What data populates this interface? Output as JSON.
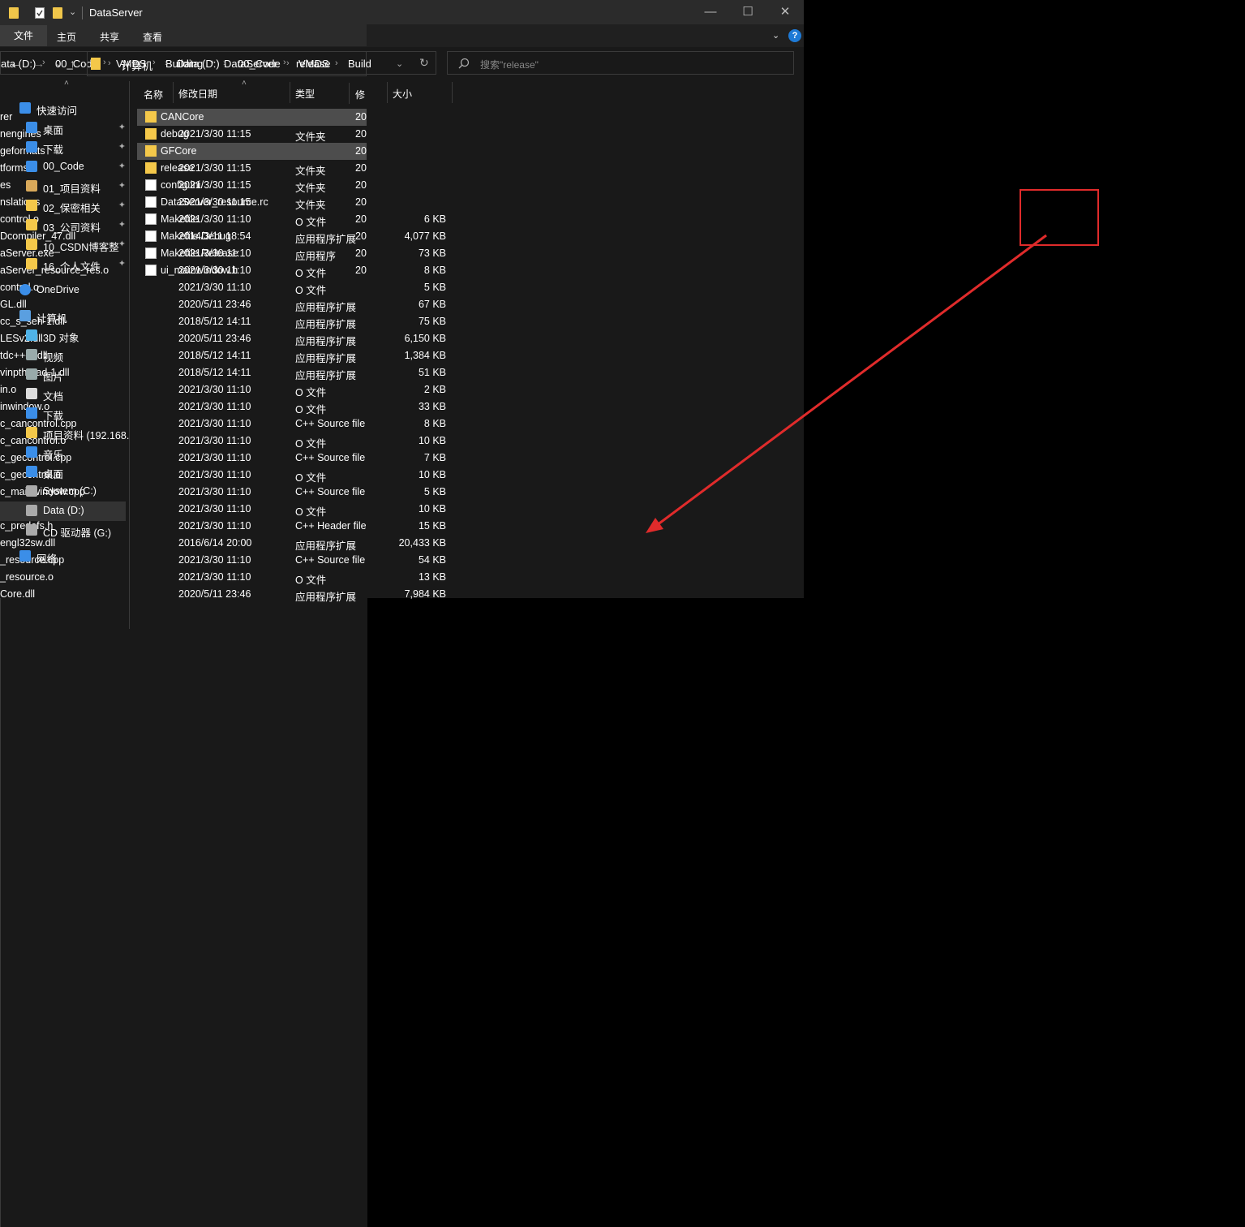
{
  "left_window": {
    "caption": {
      "minimize": "—",
      "maximize": "☐",
      "close": "✕"
    },
    "help_icon": "?",
    "address": [
      "ata (D:)",
      "00_Code",
      "VMDS",
      "Building",
      "DataServer",
      "release"
    ],
    "search_placeholder": "搜索\"release\"",
    "columns": {
      "name": "",
      "date": "修改日期",
      "type": "类型",
      "size": "大小"
    },
    "rows": [
      {
        "name": "rer",
        "date": "2021/3/30 11:15",
        "type": "文件夹",
        "size": ""
      },
      {
        "name": "nengines",
        "date": "2021/3/30 11:15",
        "type": "文件夹",
        "size": ""
      },
      {
        "name": "geformats",
        "date": "2021/3/30 11:15",
        "type": "文件夹",
        "size": ""
      },
      {
        "name": "tforms",
        "date": "2021/3/30 11:15",
        "type": "文件夹",
        "size": ""
      },
      {
        "name": "es",
        "date": "2021/3/30 11:15",
        "type": "文件夹",
        "size": ""
      },
      {
        "name": "nslations",
        "date": "2021/3/30 11:15",
        "type": "文件夹",
        "size": ""
      },
      {
        "name": "control.o",
        "date": "2021/3/30 11:10",
        "type": "O 文件",
        "size": "6 KB"
      },
      {
        "name": "Dcompiler_47.dll",
        "date": "2014/3/11 18:54",
        "type": "应用程序扩展",
        "size": "4,077 KB"
      },
      {
        "name": "aServer.exe",
        "date": "2021/3/30 11:10",
        "type": "应用程序",
        "size": "73 KB"
      },
      {
        "name": "aServer_resource_res.o",
        "date": "2021/3/30 11:10",
        "type": "O 文件",
        "size": "8 KB"
      },
      {
        "name": "control.o",
        "date": "2021/3/30 11:10",
        "type": "O 文件",
        "size": "5 KB"
      },
      {
        "name": "GL.dll",
        "date": "2020/5/11 23:46",
        "type": "应用程序扩展",
        "size": "67 KB"
      },
      {
        "name": "cc_s_seh-1.dll",
        "date": "2018/5/12 14:11",
        "type": "应用程序扩展",
        "size": "75 KB"
      },
      {
        "name": "LESv2.dll",
        "date": "2020/5/11 23:46",
        "type": "应用程序扩展",
        "size": "6,150 KB"
      },
      {
        "name": "tdc++-6.dll",
        "date": "2018/5/12 14:11",
        "type": "应用程序扩展",
        "size": "1,384 KB"
      },
      {
        "name": "vinpthread-1.dll",
        "date": "2018/5/12 14:11",
        "type": "应用程序扩展",
        "size": "51 KB"
      },
      {
        "name": "in.o",
        "date": "2021/3/30 11:10",
        "type": "O 文件",
        "size": "2 KB"
      },
      {
        "name": "inwindow.o",
        "date": "2021/3/30 11:10",
        "type": "O 文件",
        "size": "33 KB"
      },
      {
        "name": "c_cancontrol.cpp",
        "date": "2021/3/30 11:10",
        "type": "C++ Source file",
        "size": "8 KB"
      },
      {
        "name": "c_cancontrol.o",
        "date": "2021/3/30 11:10",
        "type": "O 文件",
        "size": "10 KB"
      },
      {
        "name": "c_gecontrol.cpp",
        "date": "2021/3/30 11:10",
        "type": "C++ Source file",
        "size": "7 KB"
      },
      {
        "name": "c_gecontrol.o",
        "date": "2021/3/30 11:10",
        "type": "O 文件",
        "size": "10 KB"
      },
      {
        "name": "c_mainwindow.cpp",
        "date": "2021/3/30 11:10",
        "type": "C++ Source file",
        "size": "5 KB"
      },
      {
        "name": "c_mainwindow.o",
        "date": "2021/3/30 11:10",
        "type": "O 文件",
        "size": "10 KB"
      },
      {
        "name": "c_predefs.h",
        "date": "2021/3/30 11:10",
        "type": "C++ Header file",
        "size": "15 KB"
      },
      {
        "name": "engl32sw.dll",
        "date": "2016/6/14 20:00",
        "type": "应用程序扩展",
        "size": "20,433 KB"
      },
      {
        "name": "_resource.cpp",
        "date": "2021/3/30 11:10",
        "type": "C++ Source file",
        "size": "54 KB"
      },
      {
        "name": "_resource.o",
        "date": "2021/3/30 11:10",
        "type": "O 文件",
        "size": "13 KB"
      },
      {
        "name": "Core.dll",
        "date": "2020/5/11 23:46",
        "type": "应用程序扩展",
        "size": "7,984 KB"
      }
    ]
  },
  "right_window": {
    "title": "DataServer",
    "tabs": [
      "文件",
      "主页",
      "共享",
      "查看"
    ],
    "address": [
      "计算机",
      "Data (D:)",
      "00_Code",
      "VMDS",
      "Build"
    ],
    "column_name": "名称",
    "column_date": "修",
    "nav_pane": [
      {
        "label": "快速访问",
        "icon": "star-icon",
        "pinned": false,
        "level": 0
      },
      {
        "label": "桌面",
        "icon": "desktop-icon",
        "pinned": true,
        "level": 1
      },
      {
        "label": "下载",
        "icon": "download-icon",
        "pinned": true,
        "level": 1
      },
      {
        "label": "00_Code",
        "icon": "star-icon",
        "pinned": true,
        "level": 1
      },
      {
        "label": "01_项目资料",
        "icon": "people-icon",
        "pinned": true,
        "level": 1
      },
      {
        "label": "02_保密相关",
        "icon": "folder-icon",
        "pinned": true,
        "level": 1
      },
      {
        "label": "03_公司资料",
        "icon": "folder-icon",
        "pinned": true,
        "level": 1
      },
      {
        "label": "10_CSDN博客整",
        "icon": "folder-icon",
        "pinned": true,
        "level": 1
      },
      {
        "label": "16_个人文件",
        "icon": "lock-folder-icon",
        "pinned": true,
        "level": 1
      },
      {
        "label": "OneDrive",
        "icon": "cloud-icon",
        "pinned": false,
        "level": 0
      },
      {
        "label": "计算机",
        "icon": "computer-icon",
        "pinned": false,
        "level": 0
      },
      {
        "label": "3D 对象",
        "icon": "cube-icon",
        "pinned": false,
        "level": 1
      },
      {
        "label": "视频",
        "icon": "video-icon",
        "pinned": false,
        "level": 1
      },
      {
        "label": "图片",
        "icon": "picture-icon",
        "pinned": false,
        "level": 1
      },
      {
        "label": "文档",
        "icon": "document-icon",
        "pinned": false,
        "level": 1
      },
      {
        "label": "下载",
        "icon": "download-icon",
        "pinned": false,
        "level": 1
      },
      {
        "label": "项目资料 (192.168.",
        "icon": "network-drive-icon",
        "pinned": false,
        "level": 1
      },
      {
        "label": "音乐",
        "icon": "music-icon",
        "pinned": false,
        "level": 1
      },
      {
        "label": "桌面",
        "icon": "desktop-icon",
        "pinned": false,
        "level": 1
      },
      {
        "label": "System (C:)",
        "icon": "drive-icon",
        "pinned": false,
        "level": 1
      },
      {
        "label": "Data (D:)",
        "icon": "drive-icon",
        "pinned": false,
        "level": 1,
        "selected": true
      },
      {
        "label": "CD 驱动器 (G:)",
        "icon": "cd-drive-icon",
        "pinned": false,
        "level": 1
      },
      {
        "label": "网络",
        "icon": "network-icon",
        "pinned": false,
        "level": 0
      }
    ],
    "files": [
      {
        "name": "CANCore",
        "kind": "folder",
        "date": "20",
        "highlight": true
      },
      {
        "name": "debug",
        "kind": "folder",
        "date": "20",
        "highlight": false
      },
      {
        "name": "GFCore",
        "kind": "folder",
        "date": "20",
        "highlight": true
      },
      {
        "name": "release",
        "kind": "folder",
        "date": "20",
        "highlight": false
      },
      {
        "name": "config.ini",
        "kind": "ini",
        "date": "20",
        "highlight": false
      },
      {
        "name": "DataServer_resource.rc",
        "kind": "rc",
        "date": "20",
        "highlight": false
      },
      {
        "name": "Makefile",
        "kind": "file",
        "date": "20",
        "highlight": false
      },
      {
        "name": "Makefile.Debug",
        "kind": "file",
        "date": "20",
        "highlight": false
      },
      {
        "name": "Makefile.Release",
        "kind": "file",
        "date": "20",
        "highlight": false
      },
      {
        "name": "ui_mainwindow.h",
        "kind": "header",
        "date": "20",
        "highlight": false
      }
    ]
  },
  "colors": {
    "annotation": "#e02b2b",
    "folder": "#f4c84a",
    "accent": "#1e7ad6"
  }
}
